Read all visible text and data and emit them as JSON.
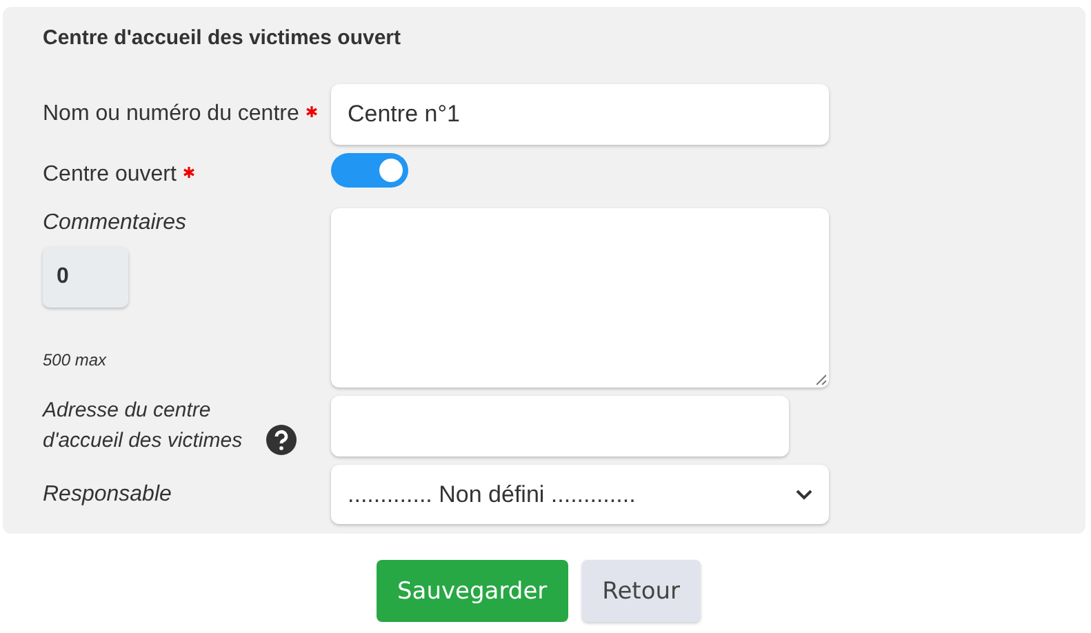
{
  "form": {
    "title": "Centre d'accueil des victimes ouvert",
    "fields": [
      {
        "kind": "text",
        "label": "Nom ou numéro du centre",
        "required": true,
        "value": "Centre n°1"
      },
      {
        "kind": "toggle",
        "label": "Centre ouvert",
        "required": true,
        "on": true
      },
      {
        "kind": "textarea",
        "label": "Commentaires",
        "required": false,
        "counter": "0",
        "limit": "500 max"
      },
      {
        "kind": "text",
        "label": "Adresse du centre d'accueil des victimes",
        "required": false,
        "help": true,
        "short": true
      },
      {
        "kind": "select",
        "label": "Responsable",
        "required": false,
        "value": "............. Non défini ............."
      }
    ]
  },
  "buttons": [
    {
      "label": "Sauvegarder",
      "kind": "primary"
    },
    {
      "label": "Retour",
      "kind": "secondary"
    }
  ]
}
